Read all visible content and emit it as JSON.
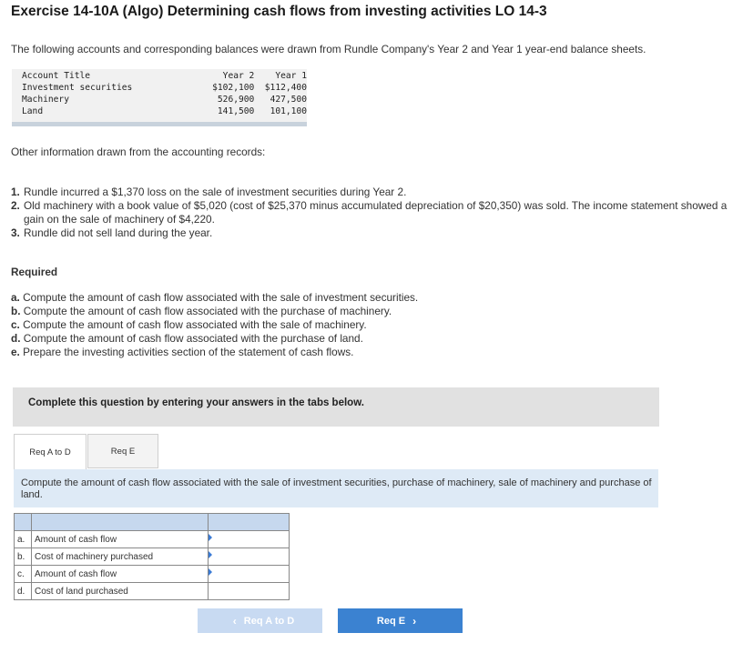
{
  "title": "Exercise 14-10A (Algo) Determining cash flows from investing activities LO 14-3",
  "intro": "The following accounts and corresponding balances were drawn from Rundle Company's Year 2 and Year 1 year-end balance sheets.",
  "balance_sheet": {
    "headers": [
      "Account Title",
      "Year 2",
      "Year 1"
    ],
    "rows": [
      [
        "Investment securities",
        "$102,100",
        "$112,400"
      ],
      [
        "Machinery",
        "526,900",
        "427,500"
      ],
      [
        "Land",
        "141,500",
        "101,100"
      ]
    ]
  },
  "other_info_label": "Other information drawn from the accounting records:",
  "info_items": [
    {
      "num": "1.",
      "text": "Rundle incurred a $1,370 loss on the sale of investment securities during Year 2."
    },
    {
      "num": "2.",
      "text": "Old machinery with a book value of $5,020 (cost of $25,370 minus accumulated depreciation of $20,350) was sold. The income statement showed a gain on the sale of machinery of $4,220."
    },
    {
      "num": "3.",
      "text": "Rundle did not sell land during the year."
    }
  ],
  "required_label": "Required",
  "requirements": [
    {
      "letter": "a.",
      "text": "Compute the amount of cash flow associated with the sale of investment securities."
    },
    {
      "letter": "b.",
      "text": "Compute the amount of cash flow associated with the purchase of machinery."
    },
    {
      "letter": "c.",
      "text": "Compute the amount of cash flow associated with the sale of machinery."
    },
    {
      "letter": "d.",
      "text": "Compute the amount of cash flow associated with the purchase of land."
    },
    {
      "letter": "e.",
      "text": "Prepare the investing activities section of the statement of cash flows."
    }
  ],
  "banner": "Complete this question by entering your answers in the tabs below.",
  "tabs": [
    "Req A to D",
    "Req E"
  ],
  "instruction": "Compute the amount of cash flow associated with the sale of investment securities, purchase of machinery, sale of machinery and purchase of land.",
  "answer_rows": [
    {
      "letter": "a.",
      "label": "Amount of cash flow",
      "value": ""
    },
    {
      "letter": "b.",
      "label": "Cost of machinery purchased",
      "value": ""
    },
    {
      "letter": "c.",
      "label": "Amount of cash flow",
      "value": ""
    },
    {
      "letter": "d.",
      "label": "Cost of land purchased",
      "value": ""
    }
  ],
  "nav": {
    "prev_label": "Req A to D",
    "next_label": "Req E"
  },
  "colors": {
    "banner_bg": "#e1e1e1",
    "instruction_bg": "#deeaf6",
    "table_header_bg": "#c6d8ee",
    "next_button": "#3b82d1",
    "prev_button": "#c8daf2"
  }
}
